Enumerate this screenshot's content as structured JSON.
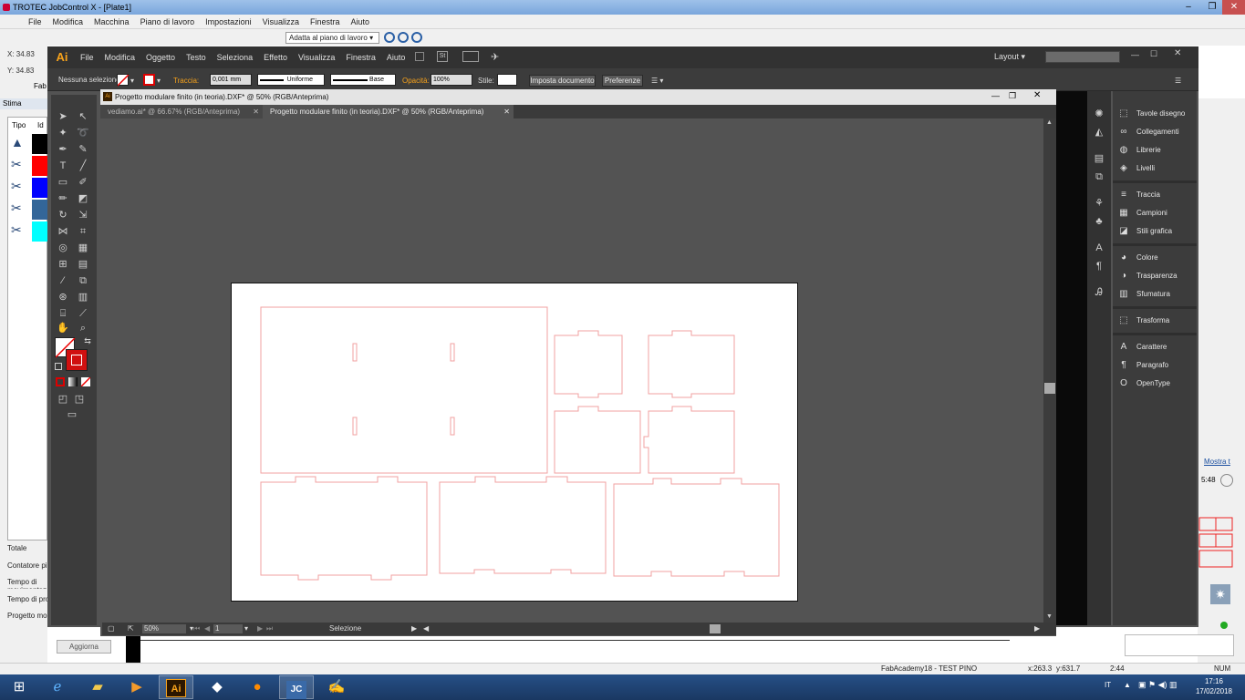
{
  "trotec": {
    "title": "TROTEC JobControl X - [Plate1]",
    "menu": [
      "File",
      "Modifica",
      "Macchina",
      "Piano di lavoro",
      "Impostazioni",
      "Visualizza",
      "Finestra",
      "Aiuto"
    ],
    "fit_select": "Adatta al piano di lavoro",
    "x_label": "X:",
    "x_value": "34.83",
    "y_label": "Y:",
    "y_value": "34.83",
    "left_tab": "Fab",
    "stima": "Stima",
    "col_tipo": "Tipo",
    "col_id": "Id",
    "summary": [
      "Totale",
      "Contatore pi",
      "Tempo di movimentaz",
      "Tempo di pro",
      "Progetto mo"
    ],
    "aggiorna": "Aggiorna",
    "mostra": "Mostra t",
    "time_right": "5:48",
    "status_job": "FabAcademy18 - TEST PINO",
    "status_x": "x:263.3",
    "status_y": "y:631.7",
    "status_time": "2:44",
    "status_num": "NUM",
    "swatch_colors": [
      "#000000",
      "#ff0000",
      "#0000ff",
      "#336699",
      "#00ffff"
    ]
  },
  "ai": {
    "logo": "Ai",
    "menu": [
      "File",
      "Modifica",
      "Oggetto",
      "Testo",
      "Seleziona",
      "Effetto",
      "Visualizza",
      "Finestra",
      "Aiuto"
    ],
    "workspace": "Layout",
    "control": {
      "selection": "Nessuna selezione",
      "traccia_label": "Traccia:",
      "traccia_value": "0,001 mm",
      "profile": "Uniforme",
      "brush": "Base",
      "opacity_label": "Opacità:",
      "opacity_value": "100%",
      "style_label": "Stile:",
      "doc_setup": "Imposta documento",
      "prefs": "Preferenze"
    },
    "doc_title": "Progetto modulare finito (in teoria).DXF* @ 50% (RGB/Anteprima)",
    "tabs": [
      {
        "label": "vediamo.ai* @ 66.67% (RGB/Anteprima)"
      },
      {
        "label": "Progetto modulare finito (in teoria).DXF* @ 50% (RGB/Anteprima)"
      }
    ],
    "status": {
      "zoom": "50%",
      "page": "1",
      "mode": "Selezione"
    },
    "panels": [
      {
        "label": "Tavole disegno",
        "icon": "artboards-icon"
      },
      {
        "label": "Collegamenti",
        "icon": "links-icon"
      },
      {
        "label": "Librerie",
        "icon": "libraries-icon"
      },
      {
        "label": "Livelli",
        "icon": "layers-icon"
      },
      {
        "label": "Traccia",
        "icon": "stroke-icon"
      },
      {
        "label": "Campioni",
        "icon": "swatches-icon"
      },
      {
        "label": "Stili grafica",
        "icon": "graphic-styles-icon"
      },
      {
        "label": "Colore",
        "icon": "color-icon"
      },
      {
        "label": "Trasparenza",
        "icon": "transparency-icon"
      },
      {
        "label": "Sfumatura",
        "icon": "gradient-icon"
      },
      {
        "label": "Trasforma",
        "icon": "transform-icon"
      },
      {
        "label": "Carattere",
        "icon": "character-icon"
      },
      {
        "label": "Paragrafo",
        "icon": "paragraph-icon"
      },
      {
        "label": "OpenType",
        "icon": "opentype-icon"
      }
    ],
    "accent": "#f7a21b",
    "cut_line_color": "#f2a0a0"
  },
  "taskbar": {
    "lang": "IT",
    "time": "17:16",
    "date": "17/02/2018",
    "apps": [
      "start-icon",
      "ie-icon",
      "explorer-icon",
      "media-icon",
      "illustrator-icon",
      "inkscape-icon",
      "firefox-icon",
      "jobcontrol-icon",
      "tool-icon"
    ]
  }
}
